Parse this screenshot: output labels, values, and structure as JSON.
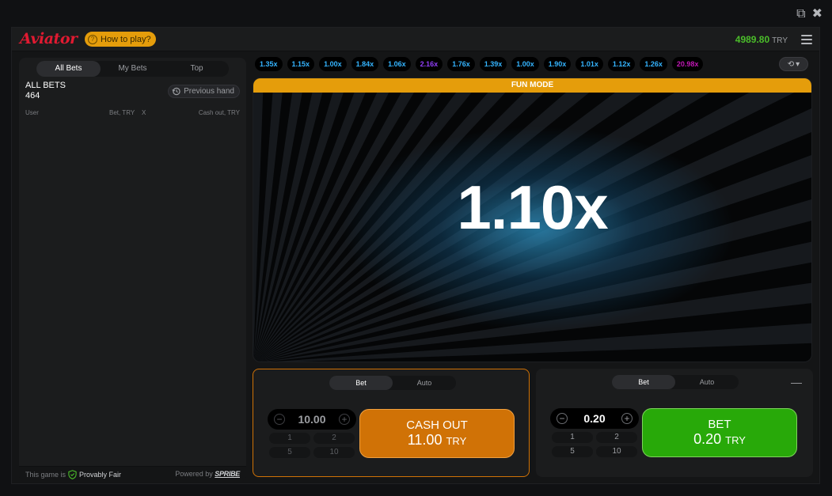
{
  "window": {
    "popout_icon": "external-link-icon",
    "close_icon": "close-icon"
  },
  "header": {
    "logo": "Aviator",
    "howto_label": "How to play?",
    "balance": "4989.80",
    "currency": "TRY"
  },
  "left": {
    "tabs": [
      "All Bets",
      "My Bets",
      "Top"
    ],
    "active_tab": "All Bets",
    "all_bets_label": "ALL BETS",
    "all_bets_count": "464",
    "previous_hand": "Previous hand",
    "columns": {
      "user": "User",
      "bet": "Bet, TRY",
      "x": "X",
      "cashout": "Cash out, TRY"
    },
    "footer_text": "This game is",
    "footer_fair": "Provably Fair",
    "footer_powered": "Powered by",
    "footer_brand": "SPRIBE"
  },
  "history": [
    {
      "value": "1.35x",
      "color": "#34b4ff"
    },
    {
      "value": "1.15x",
      "color": "#34b4ff"
    },
    {
      "value": "1.00x",
      "color": "#34b4ff"
    },
    {
      "value": "1.84x",
      "color": "#34b4ff"
    },
    {
      "value": "1.06x",
      "color": "#34b4ff"
    },
    {
      "value": "2.16x",
      "color": "#913ef8"
    },
    {
      "value": "1.76x",
      "color": "#34b4ff"
    },
    {
      "value": "1.39x",
      "color": "#34b4ff"
    },
    {
      "value": "1.00x",
      "color": "#34b4ff"
    },
    {
      "value": "1.90x",
      "color": "#34b4ff"
    },
    {
      "value": "1.01x",
      "color": "#34b4ff"
    },
    {
      "value": "1.12x",
      "color": "#34b4ff"
    },
    {
      "value": "1.26x",
      "color": "#34b4ff"
    },
    {
      "value": "20.98x",
      "color": "#c017b4"
    }
  ],
  "game": {
    "mode_banner": "FUN MODE",
    "multiplier": "1.10x"
  },
  "panel1": {
    "tabs": [
      "Bet",
      "Auto"
    ],
    "active_tab": "Bet",
    "stake": "10.00",
    "quick": [
      "1",
      "2",
      "5",
      "10"
    ],
    "button_line1": "CASH OUT",
    "button_amount": "11.00",
    "button_currency": "TRY"
  },
  "panel2": {
    "tabs": [
      "Bet",
      "Auto"
    ],
    "active_tab": "Bet",
    "stake": "0.20",
    "quick": [
      "1",
      "2",
      "5",
      "10"
    ],
    "button_line1": "BET",
    "button_amount": "0.20",
    "button_currency": "TRY",
    "remove_label": "—"
  }
}
